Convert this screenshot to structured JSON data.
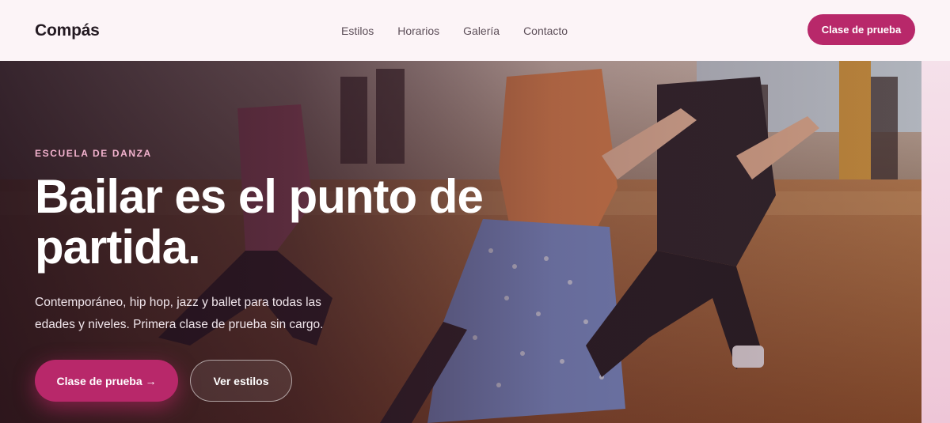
{
  "header": {
    "brand": "Compás",
    "nav": [
      "Estilos",
      "Horarios",
      "Galería",
      "Contacto"
    ],
    "cta": "Clase de prueba"
  },
  "hero": {
    "eyebrow": "ESCUELA DE DANZA",
    "title": "Bailar es el punto de partida.",
    "subtitle": "Contemporáneo, hip hop, jazz y ballet para todas las edades y niveles. Primera clase de prueba sin cargo.",
    "primary_button": "Clase de prueba →",
    "secondary_button": "Ver estilos"
  },
  "colors": {
    "accent": "#b8286a",
    "header_bg": "#fcf4f7",
    "eyebrow": "#f4b3cf"
  }
}
